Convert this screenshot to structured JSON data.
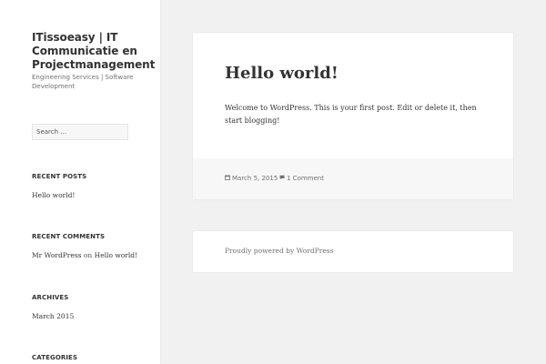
{
  "site": {
    "title": "ITissoeasy | IT Communicatie en Projectmanagement",
    "description": "Engineering Services | Software Development"
  },
  "search": {
    "placeholder": "Search …"
  },
  "widgets": {
    "recent_posts": {
      "title": "RECENT POSTS",
      "items": [
        "Hello world!"
      ]
    },
    "recent_comments": {
      "title": "RECENT COMMENTS",
      "author": "Mr WordPress",
      "joiner": "on",
      "post": "Hello world!"
    },
    "archives": {
      "title": "ARCHIVES",
      "items": [
        "March 2015"
      ]
    },
    "categories": {
      "title": "CATEGORIES"
    }
  },
  "post": {
    "title": "Hello world!",
    "content": "Welcome to WordPress. This is your first post. Edit or delete it, then start blogging!",
    "date": "March 5, 2015",
    "comments": "1 Comment",
    "date_icon": "calendar-icon",
    "comments_icon": "comment-icon"
  },
  "footer": {
    "text": "Proudly powered by WordPress"
  }
}
